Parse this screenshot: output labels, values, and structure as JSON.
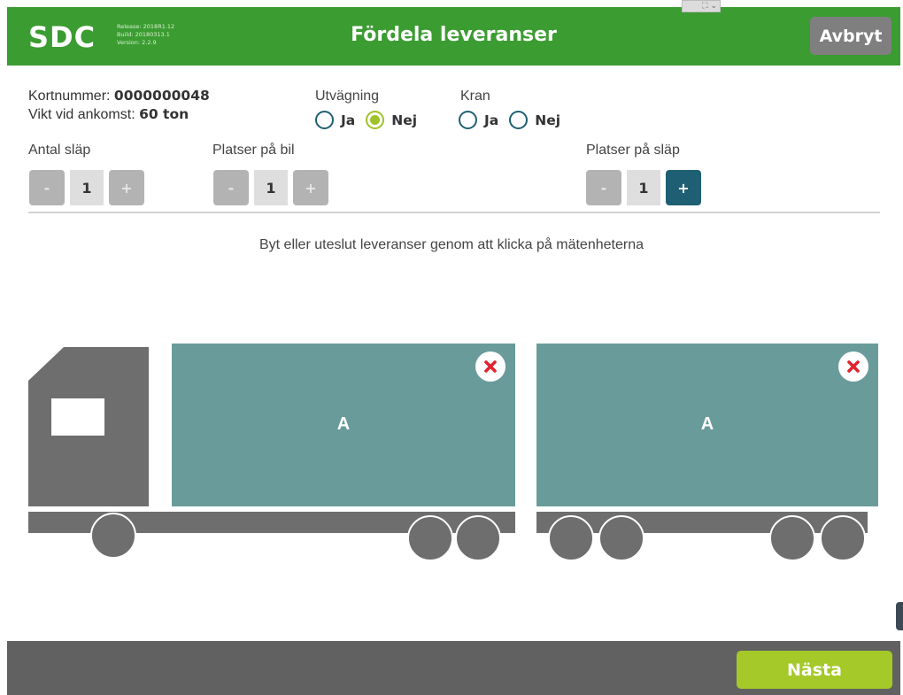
{
  "header": {
    "logo_text": "SDC",
    "release": "Release: 2018R1.12",
    "build": "Build: 20180313.1",
    "version": "Version: 2.2.9",
    "title": "Fördela leveranser",
    "cancel_label": "Avbryt",
    "mini_control": "⛶ ⌄"
  },
  "info": {
    "card_label": "Kortnummer:",
    "card_value": "0000000048",
    "weight_label": "Vikt vid ankomst:",
    "weight_value": "60 ton"
  },
  "utvagning": {
    "label": "Utvägning",
    "options": [
      "Ja",
      "Nej"
    ],
    "selected": "Nej"
  },
  "kran": {
    "label": "Kran",
    "options": [
      "Ja",
      "Nej"
    ],
    "selected": null
  },
  "steppers": {
    "antal_slap": {
      "label": "Antal släp",
      "value": "1",
      "minus": "-",
      "plus": "+"
    },
    "platser_bil": {
      "label": "Platser på bil",
      "value": "1",
      "minus": "-",
      "plus": "+"
    },
    "platser_slap": {
      "label": "Platser på släp",
      "value": "1",
      "minus": "-",
      "plus": "+"
    }
  },
  "hint": "Byt eller uteslut leveranser genom att klicka på mätenheterna",
  "truck": {
    "cargo_label": "A"
  },
  "trailer": {
    "cargo_label": "A"
  },
  "footer": {
    "next_label": "Nästa"
  },
  "colors": {
    "header_green": "#3b9c31",
    "cargo_teal": "#6a9b9b",
    "vehicle_gray": "#6e6e6e",
    "accent_lime": "#a4c929",
    "active_blue": "#1f5f74",
    "remove_red": "#e0242e"
  }
}
